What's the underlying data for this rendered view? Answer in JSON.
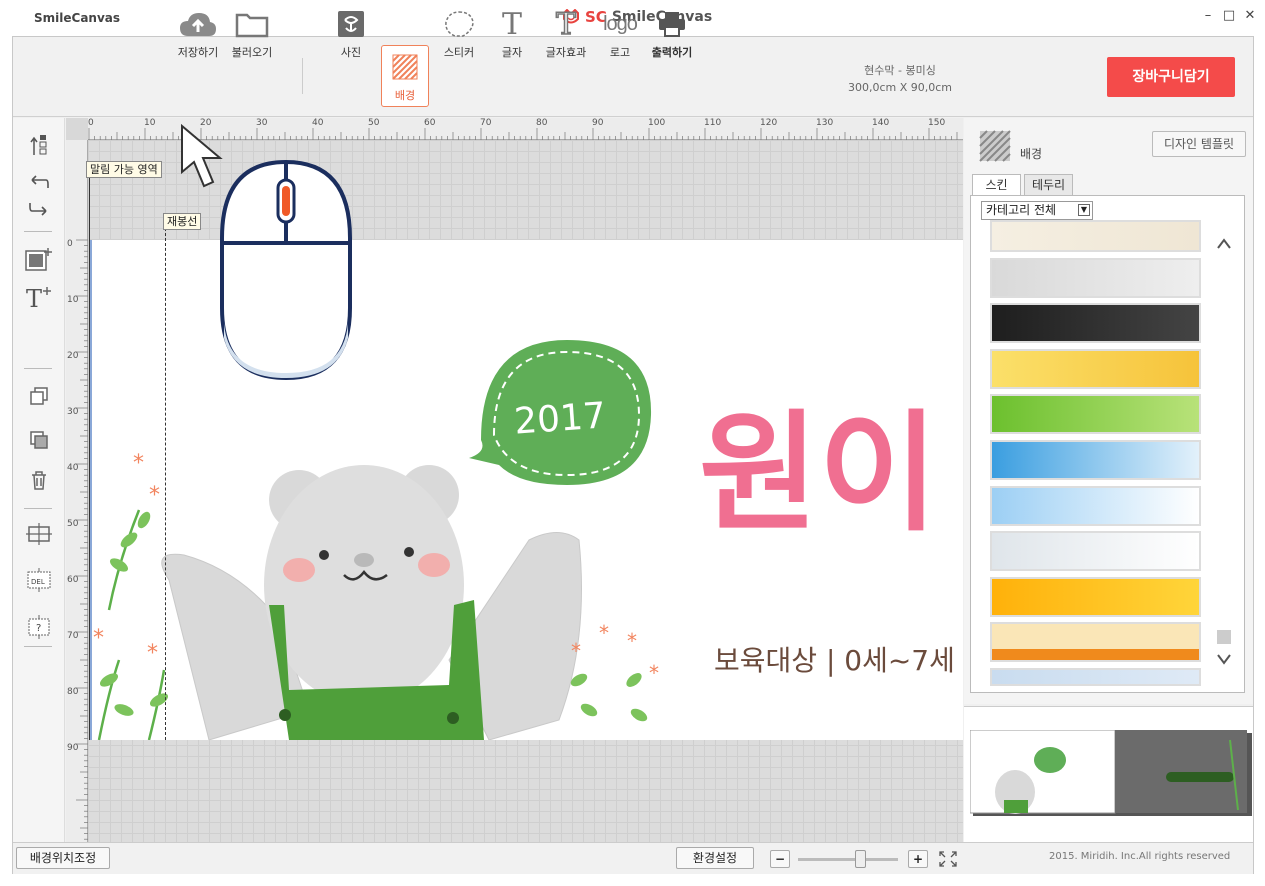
{
  "titlebar": {
    "app_name": "SmileCanvas",
    "brand_prefix": "SC",
    "brand_name": "SmileCanvas",
    "minimize": "–",
    "maximize": "□",
    "close": "✕"
  },
  "toolbar": {
    "save": "저장하기",
    "load": "불러오기",
    "photo": "사진",
    "background": "배경",
    "sticker": "스티커",
    "text": "글자",
    "text_effect": "글자효과",
    "logo": "로고",
    "print": "출력하기",
    "doc_info_line1": "현수막 - 봉미싱",
    "doc_info_line2": "300,0cm X 90,0cm",
    "cart": "장바구니담기"
  },
  "canvas": {
    "fold_area_label": "말림 가능 영역",
    "seam_label": "재봉선",
    "ruler_top": [
      "0",
      "10",
      "20",
      "30",
      "40",
      "50",
      "60",
      "70",
      "80",
      "90",
      "100",
      "110",
      "120",
      "130",
      "140",
      "150"
    ],
    "ruler_left": [
      "0",
      "10",
      "20",
      "30",
      "40",
      "50",
      "60",
      "70",
      "80",
      "90"
    ],
    "design_year": "2017",
    "design_heading": "원이",
    "design_subtitle": "보육대상 | 0세~7세"
  },
  "right_panel": {
    "title": "배경",
    "design_template": "디자인 템플릿",
    "tabs": [
      "스킨",
      "테두리"
    ],
    "category_select": "카테고리 전체",
    "swatches": [
      {
        "name": "cream",
        "colors": [
          "#f5efe2",
          "#efe6d4"
        ]
      },
      {
        "name": "silver-lights",
        "colors": [
          "#d9d9d9",
          "#eeeeee"
        ]
      },
      {
        "name": "black",
        "colors": [
          "#1e1e1e",
          "#444444"
        ]
      },
      {
        "name": "yellow-floral",
        "colors": [
          "#fbe06a",
          "#f6c33a"
        ]
      },
      {
        "name": "green",
        "colors": [
          "#6cc02e",
          "#b8e279"
        ]
      },
      {
        "name": "blue-sky",
        "colors": [
          "#3a9ee0",
          "#e3f1fb"
        ]
      },
      {
        "name": "light-blue",
        "colors": [
          "#9ccff4",
          "#ffffff"
        ]
      },
      {
        "name": "grey-mist",
        "colors": [
          "#dfe5ea",
          "#ffffff"
        ]
      },
      {
        "name": "orange-burst",
        "colors": [
          "#ffb10a",
          "#ffd53a"
        ]
      },
      {
        "name": "peach-orange",
        "colors": [
          "#fae6b7",
          "#f08a1c"
        ]
      },
      {
        "name": "pale-blue",
        "colors": [
          "#c9dcef",
          "#dfeaf6"
        ]
      }
    ]
  },
  "status": {
    "bg_position": "배경위치조정",
    "settings": "환경설정",
    "zoom_minus": "−",
    "zoom_plus": "+",
    "copyright": "2015. Miridih. Inc.All rights reserved"
  },
  "colors": {
    "accent": "#f44b4a",
    "bg_tool_active": "#f0825a",
    "bubble_green": "#5fae57",
    "heading_pink": "#f06f91"
  }
}
